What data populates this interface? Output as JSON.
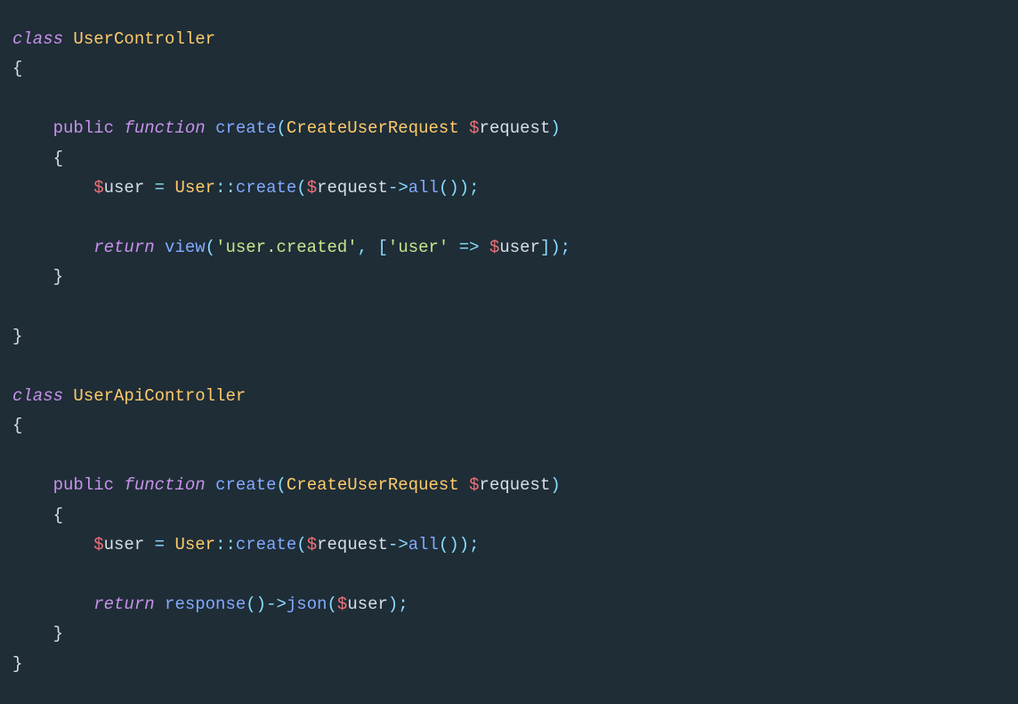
{
  "code": {
    "kw_class": "class",
    "kw_public": "public",
    "kw_function": "function",
    "kw_return": "return",
    "sigil": "$",
    "class1": {
      "name": "UserController",
      "method": {
        "name": "create",
        "param_type": "CreateUserRequest",
        "param_name": "request",
        "body": {
          "assign_var": "user",
          "rhs_class": "User",
          "rhs_method": "create",
          "rhs_arg_var": "request",
          "rhs_arg_call": "all",
          "return_fn": "view",
          "return_str1": "'user.created'",
          "return_arr_key": "'user'",
          "return_arr_val": "user"
        }
      }
    },
    "class2": {
      "name": "UserApiController",
      "method": {
        "name": "create",
        "param_type": "CreateUserRequest",
        "param_name": "request",
        "body": {
          "assign_var": "user",
          "rhs_class": "User",
          "rhs_method": "create",
          "rhs_arg_var": "request",
          "rhs_arg_call": "all",
          "return_fn1": "response",
          "return_fn2": "json",
          "return_arg": "user"
        }
      }
    }
  }
}
